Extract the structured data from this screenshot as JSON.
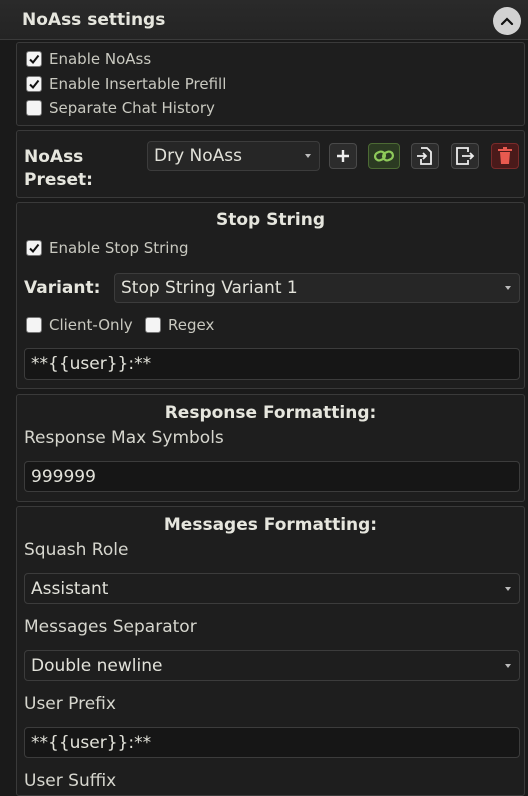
{
  "header": {
    "title": "NoAss settings"
  },
  "general": {
    "enable_noass": {
      "label": "Enable NoAss",
      "checked": true
    },
    "enable_prefill": {
      "label": "Enable Insertable Prefill",
      "checked": true
    },
    "separate_history": {
      "label": "Separate Chat History",
      "checked": false
    }
  },
  "preset": {
    "label_line1": "NoAss",
    "label_line2": "Preset:",
    "selected": "Dry NoAss",
    "buttons": [
      "add-icon",
      "link-icon",
      "import-icon",
      "export-icon",
      "trash-icon"
    ]
  },
  "stop_string": {
    "title": "Stop String",
    "enable": {
      "label": "Enable Stop String",
      "checked": true
    },
    "variant_label": "Variant:",
    "variant_value": "Stop String Variant 1",
    "client_only": {
      "label": "Client-Only",
      "checked": false
    },
    "regex": {
      "label": "Regex",
      "checked": false
    },
    "value": "**{{user}}:**"
  },
  "response": {
    "title": "Response Formatting:",
    "max_symbols_label": "Response Max Symbols",
    "max_symbols_value": "999999"
  },
  "messages": {
    "title": "Messages Formatting:",
    "squash_role_label": "Squash Role",
    "squash_role_value": "Assistant",
    "separator_label": "Messages Separator",
    "separator_value": "Double newline",
    "user_prefix_label": "User Prefix",
    "user_prefix_value": "**{{user}}:**",
    "user_suffix_label": "User Suffix"
  },
  "colors": {
    "accent_green": "#8ec95a",
    "danger": "#c0392b",
    "background": "#1a1a1a"
  }
}
